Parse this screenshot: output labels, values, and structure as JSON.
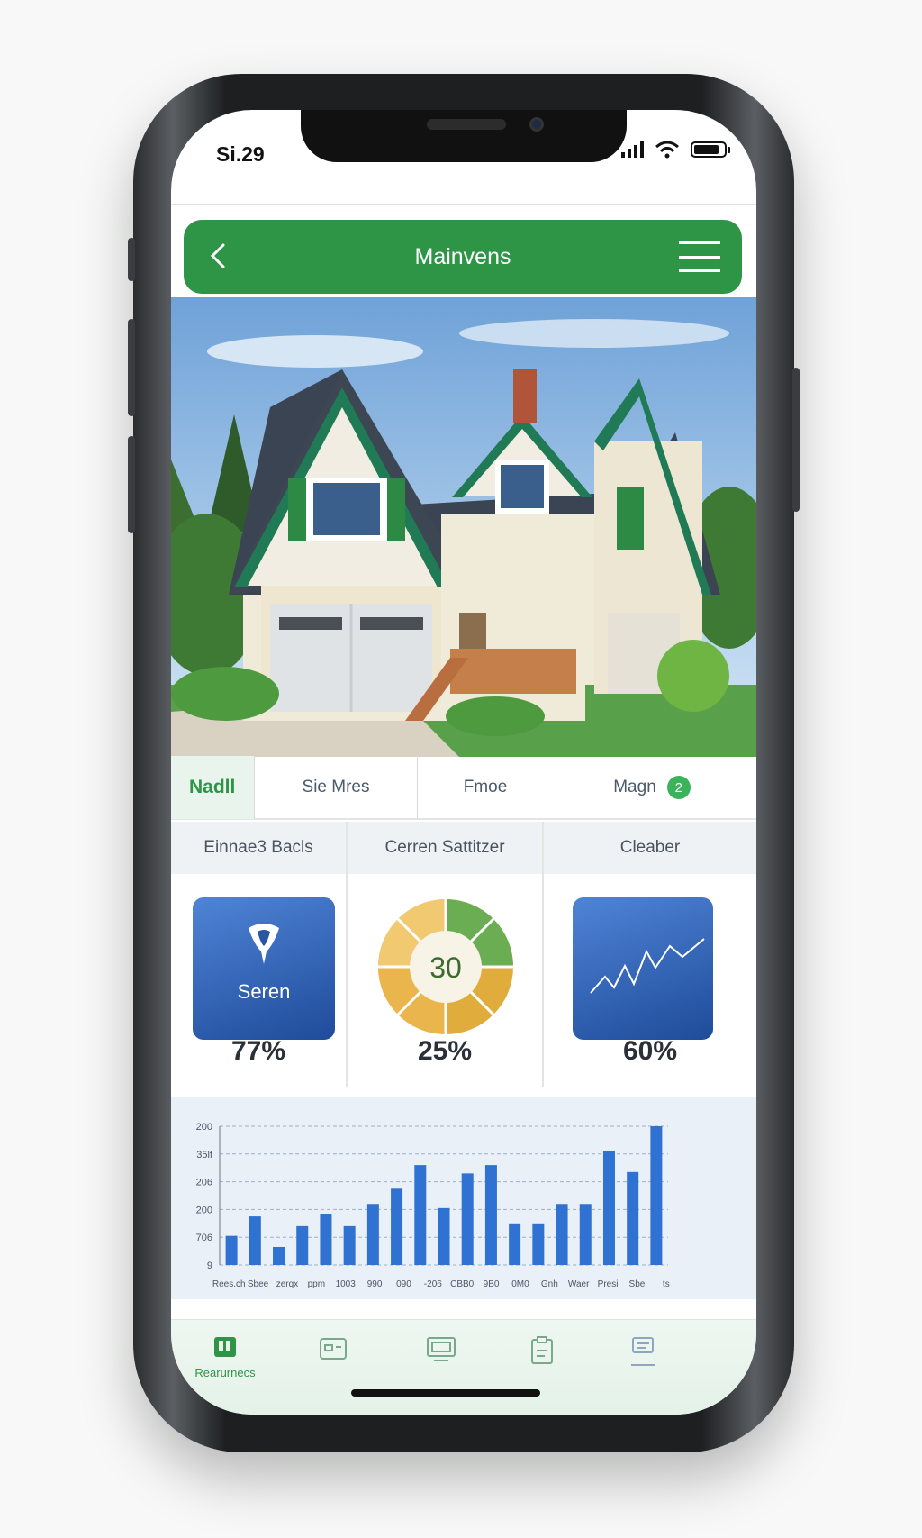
{
  "status_bar": {
    "time": "Si.29"
  },
  "header": {
    "title": "Mainvens",
    "back_icon": "chevron-left-icon",
    "menu_icon": "menu-icon"
  },
  "nav_tabs": [
    {
      "label": "Nadll",
      "active": true
    },
    {
      "label": "Sie Mres"
    },
    {
      "label": "Fmoe"
    },
    {
      "label": "Magn",
      "badge": "2"
    }
  ],
  "cards": [
    {
      "title": "Einnae3 Bacls",
      "tile_label": "Seren",
      "icon": "pin-icon",
      "percent": "77%"
    },
    {
      "title": "Cerren Sattitzer",
      "center_value": "30",
      "icon": "donut-chart",
      "percent": "25%"
    },
    {
      "title": "Cleaber",
      "icon": "line-chart-icon",
      "percent": "60%"
    }
  ],
  "chart_data": {
    "type": "bar",
    "y_ticks": [
      "9",
      "706",
      "200",
      "206",
      "35lf",
      "200"
    ],
    "x_tick_labels": [
      "Rees.ch",
      "Sbee",
      "zerqx",
      "ppm",
      "1003",
      "990",
      "090",
      "-206",
      "CBB0",
      "9B0",
      "0M0",
      "Gnh",
      "Waer",
      "Presi",
      "Sbe",
      "ts"
    ],
    "values": [
      2.1,
      3.5,
      1.3,
      2.8,
      3.7,
      2.8,
      4.4,
      5.5,
      7.2,
      4.1,
      6.6,
      7.2,
      3.0,
      3.0,
      4.4,
      4.4,
      8.2,
      6.7,
      10.0
    ],
    "grid": true,
    "colors": {
      "bar": "#2f72d1"
    }
  },
  "tabbar": [
    {
      "label": "Rearurnecs",
      "icon": "dashboard-icon",
      "active": true
    },
    {
      "label": "",
      "icon": "card-icon"
    },
    {
      "label": "",
      "icon": "monitor-icon"
    },
    {
      "label": "",
      "icon": "clipboard-icon"
    },
    {
      "label": "",
      "icon": "list-icon"
    }
  ],
  "colors": {
    "brand_green": "#2e9547",
    "tile_blue": "#2f5fb3",
    "donut_green": "#6aad52",
    "donut_gold": "#e0ac3c"
  }
}
